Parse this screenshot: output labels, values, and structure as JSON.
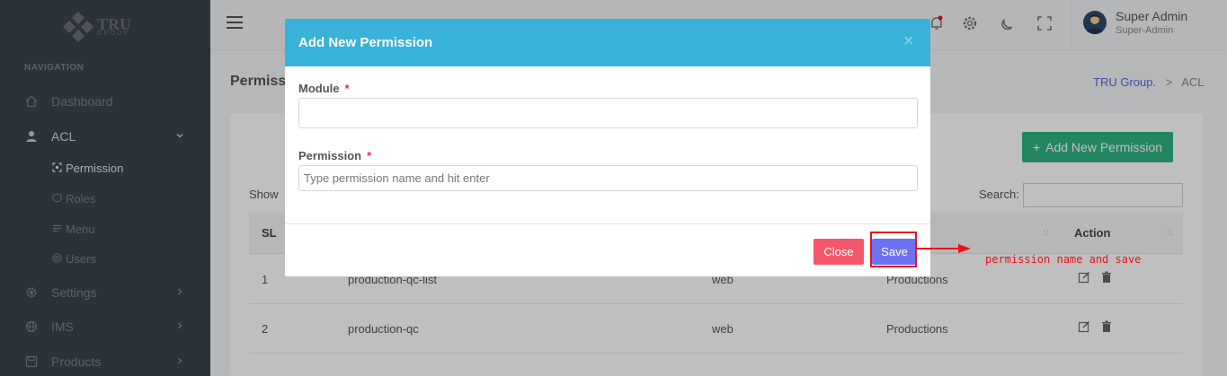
{
  "brand": {
    "logo_text": "TRU",
    "logo_sub": "GROUP"
  },
  "sidebar": {
    "heading": "NAVIGATION",
    "items": [
      {
        "label": "Dashboard",
        "icon": "home-icon"
      },
      {
        "label": "ACL",
        "icon": "user-icon",
        "expanded": true
      },
      {
        "label": "Settings",
        "icon": "gear-icon"
      },
      {
        "label": "IMS",
        "icon": "globe-icon"
      },
      {
        "label": "Products",
        "icon": "save-icon"
      }
    ],
    "acl_children": [
      {
        "label": "Permission",
        "icon": "scan-icon",
        "active": true
      },
      {
        "label": "Roles",
        "icon": "shield-icon"
      },
      {
        "label": "Menu",
        "icon": "list-icon"
      },
      {
        "label": "Users",
        "icon": "at-icon"
      }
    ]
  },
  "topbar": {
    "user_name": "Super Admin",
    "user_role": "Super-Admin"
  },
  "page": {
    "title": "Permissi",
    "breadcrumb_root": "TRU Group.",
    "breadcrumb_sep": ">",
    "breadcrumb_current": "ACL",
    "add_button": "Add New Permission",
    "show_label": "Show",
    "search_label": "Search:"
  },
  "table": {
    "headers": {
      "sl": "SL",
      "action": "Action"
    },
    "rows": [
      {
        "sl": "1",
        "name": "production-qc-list",
        "guard": "web",
        "module": "Productions"
      },
      {
        "sl": "2",
        "name": "production-qc",
        "guard": "web",
        "module": "Productions"
      }
    ]
  },
  "modal": {
    "title": "Add New Permission",
    "close_x": "×",
    "module_label": "Module",
    "permission_label": "Permission",
    "required_mark": "*",
    "module_value": "",
    "permission_placeholder": "Type permission name and hit enter",
    "close_button": "Close",
    "save_button": "Save"
  },
  "annotation": {
    "text": "permission name and save"
  },
  "colors": {
    "sidebar_bg": "#3b434c",
    "modal_header": "#38b2d8",
    "add_button": "#2fb380",
    "close_button": "#f5576c",
    "save_button": "#6f72f0",
    "annotation": "#e8141c"
  }
}
